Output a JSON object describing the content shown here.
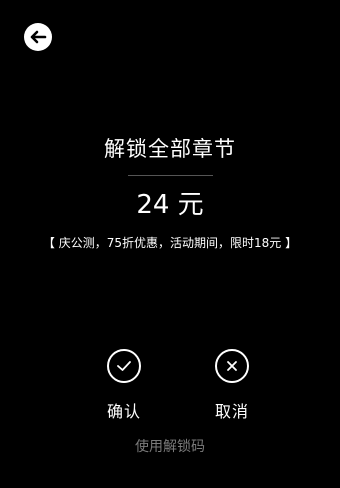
{
  "header": {
    "back_icon": "arrow-left-icon"
  },
  "dialog": {
    "title": "解锁全部章节",
    "price": "24 元",
    "promo": "【 庆公测，75折优惠，活动期间，限时18元 】"
  },
  "actions": {
    "confirm": {
      "label": "确认",
      "icon": "check-icon"
    },
    "cancel": {
      "label": "取消",
      "icon": "close-icon"
    }
  },
  "footer": {
    "unlock_code_link": "使用解锁码"
  },
  "colors": {
    "background": "#000000",
    "text": "#ffffff",
    "muted": "#7a7a7a",
    "divider": "#555555"
  }
}
